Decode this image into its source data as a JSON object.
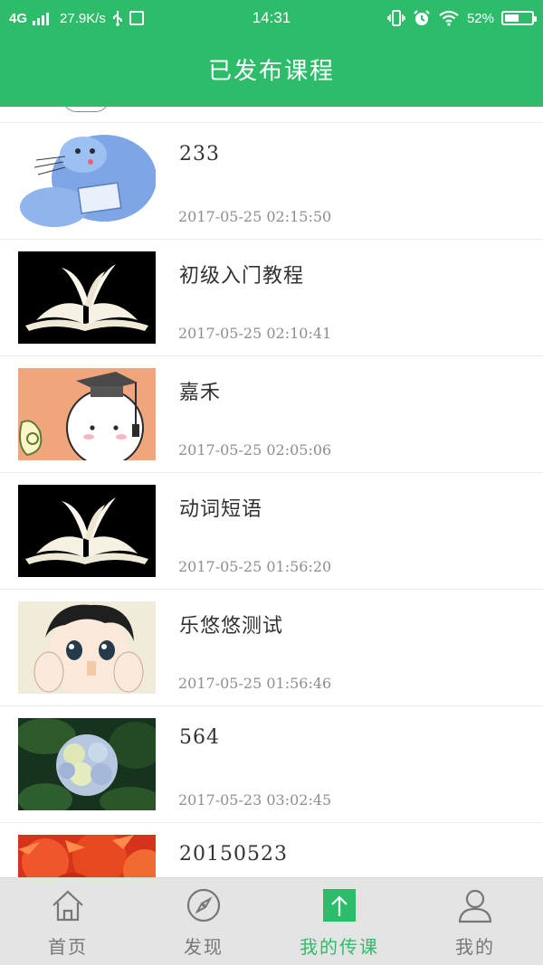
{
  "status_bar": {
    "network": "4G",
    "speed": "27.9K/s",
    "time": "14:31",
    "battery": "52%",
    "battery_level": 0.52
  },
  "header": {
    "title": "已发布课程"
  },
  "courses": [
    {
      "name": "233",
      "time": "2017-05-25 02:15:50",
      "thumbnail": "blue-mole-cartoon"
    },
    {
      "name": "初级入门教程",
      "time": "2017-05-25 02:10:41",
      "thumbnail": "open-book-on-black"
    },
    {
      "name": "嘉禾",
      "time": "2017-05-25 02:05:06",
      "thumbnail": "graduate-cartoon"
    },
    {
      "name": "动词短语",
      "time": "2017-05-25 01:56:20",
      "thumbnail": "open-book-on-black"
    },
    {
      "name": "乐悠悠测试",
      "time": "2017-05-25 01:56:46",
      "thumbnail": "anime-girl-face"
    },
    {
      "name": "564",
      "time": "2017-05-23 03:02:45",
      "thumbnail": "hydrangea-flower"
    },
    {
      "name": "20150523",
      "time": "",
      "thumbnail": "red-flower"
    }
  ],
  "tabs": [
    {
      "label": "首页",
      "icon": "home-icon",
      "active": false
    },
    {
      "label": "发现",
      "icon": "compass-icon",
      "active": false
    },
    {
      "label": "我的传课",
      "icon": "upload-icon",
      "active": true
    },
    {
      "label": "我的",
      "icon": "user-icon",
      "active": false
    }
  ],
  "colors": {
    "accent": "#2dbd6a",
    "tab_bg": "#e4e4e4",
    "text": "#333333",
    "muted": "#8e8e8e"
  }
}
